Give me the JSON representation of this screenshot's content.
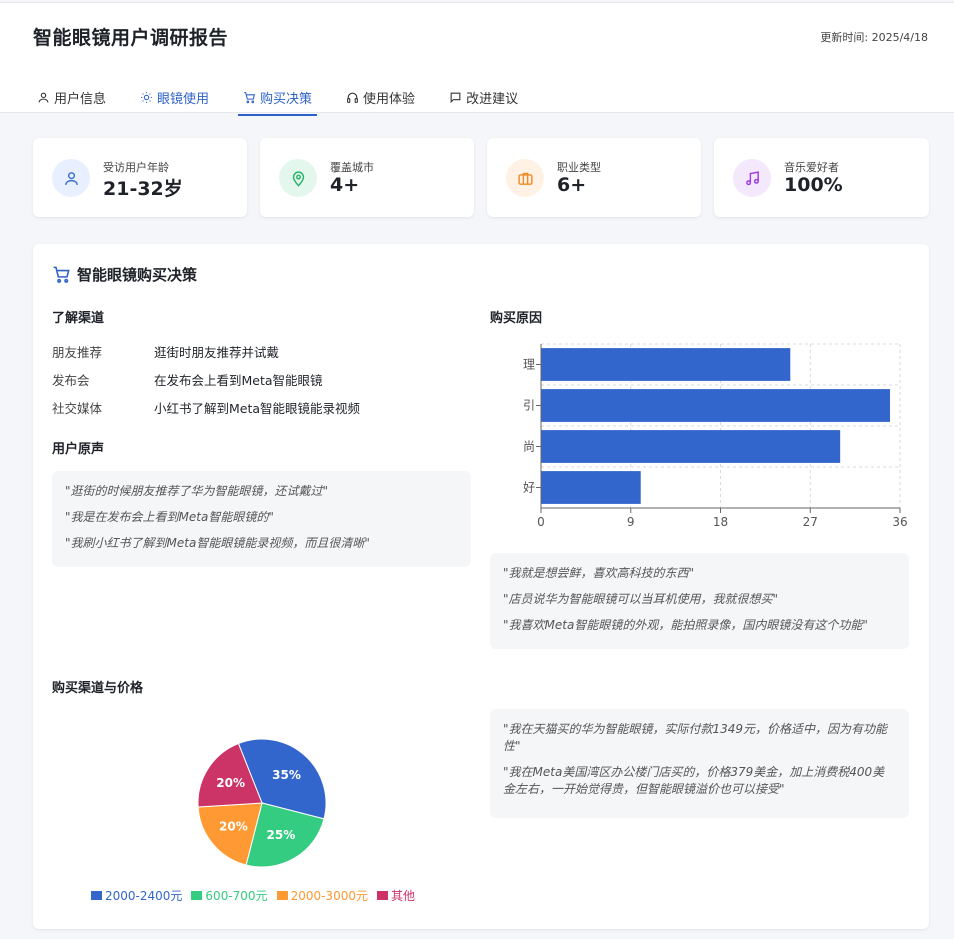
{
  "header": {
    "title": "智能眼镜用户调研报告",
    "updated": "更新时间: 2025/4/18",
    "tabs": [
      {
        "label": "用户信息",
        "icon": "user-icon"
      },
      {
        "label": "眼镜使用",
        "icon": "sun-icon"
      },
      {
        "label": "购买决策",
        "icon": "cart-icon",
        "active": true
      },
      {
        "label": "使用体验",
        "icon": "headphones-icon"
      },
      {
        "label": "改进建议",
        "icon": "message-icon"
      }
    ]
  },
  "stats": [
    {
      "label": "受访用户年龄",
      "value": "21-32岁",
      "icon": "user-icon",
      "color": "#3b6fd1",
      "bg": "#e8efff"
    },
    {
      "label": "覆盖城市",
      "value": "4+",
      "icon": "map-pin-icon",
      "color": "#27b36b",
      "bg": "#e4f7ec"
    },
    {
      "label": "职业类型",
      "value": "6+",
      "icon": "briefcase-icon",
      "color": "#f08a24",
      "bg": "#fff1e4"
    },
    {
      "label": "音乐爱好者",
      "value": "100%",
      "icon": "music-icon",
      "color": "#9b3be3",
      "bg": "#f4e8fd"
    }
  ],
  "panel": {
    "title": "智能眼镜购买决策",
    "channels_title": "了解渠道",
    "channels": [
      {
        "key": "朋友推荐",
        "value": "逛街时朋友推荐并试戴"
      },
      {
        "key": "发布会",
        "value": "在发布会上看到Meta智能眼镜"
      },
      {
        "key": "社交媒体",
        "value": "小红书了解到Meta智能眼镜能录视频"
      }
    ],
    "voices_title": "用户原声",
    "voices": [
      "\"逛街的时候朋友推荐了华为智能眼镜，还试戴过\"",
      "\"我是在发布会上看到Meta智能眼镜的\"",
      "\"我刷小红书了解到Meta智能眼镜能录视频，而且很清晰\""
    ],
    "reasons_title": "购买原因",
    "reason_quotes": [
      "\"我就是想尝鲜，喜欢高科技的东西\"",
      "\"店员说华为智能眼镜可以当耳机使用，我就很想买\"",
      "\"我喜欢Meta智能眼镜的外观，能拍照录像，国内眼镜没有这个功能\""
    ],
    "price_title": "购买渠道与价格",
    "price_quotes": [
      "\"我在天猫买的华为智能眼镜，实际付款1349元，价格适中，因为有功能性\"",
      "\"我在Meta美国湾区办公楼门店买的，价格379美金，加上消费税400美金左右，一开始觉得贵，但智能眼镜溢价也可以接受\""
    ]
  },
  "chart_data": [
    {
      "type": "bar",
      "orientation": "horizontal",
      "categories": [
        "尝鲜心理",
        "功能吸引",
        "外观时尚",
        "品牌偏好"
      ],
      "values": [
        25,
        35,
        30,
        10
      ],
      "xticks": [
        "0",
        "9",
        "18",
        "27",
        "36"
      ],
      "xlim": [
        0,
        36
      ],
      "grid": true,
      "color": "#3366cc"
    },
    {
      "type": "pie",
      "labels": [
        "2000-2400元",
        "600-700元",
        "2000-3000元",
        "其他"
      ],
      "values": [
        35,
        25,
        20,
        20
      ],
      "value_labels": [
        "35%",
        "25%",
        "20%",
        "20%"
      ],
      "colors": [
        "#3366cc",
        "#33cc80",
        "#ff9933",
        "#cc3366"
      ],
      "legend": "bottom"
    }
  ]
}
